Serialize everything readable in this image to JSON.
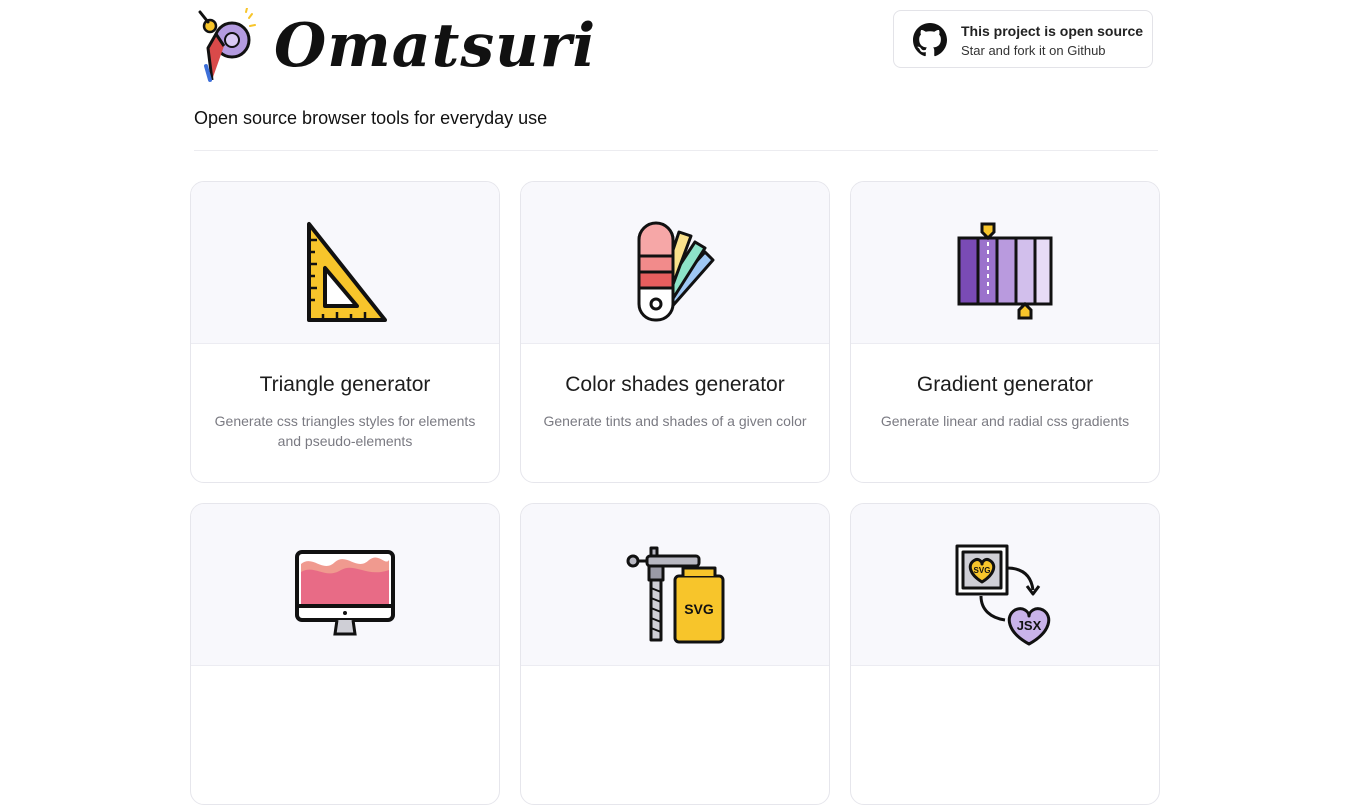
{
  "brand": {
    "name": "Omatsuri",
    "tagline": "Open source browser tools for everyday use"
  },
  "github": {
    "title": "This project is open source",
    "subtitle": "Star and fork it on Github",
    "icon": "github-icon"
  },
  "tools": [
    {
      "title": "Triangle generator",
      "description": "Generate css triangles styles for elements and pseudo-elements",
      "icon": "triangle-ruler-icon"
    },
    {
      "title": "Color shades generator",
      "description": "Generate tints and shades of a given color",
      "icon": "color-swatch-fan-icon"
    },
    {
      "title": "Gradient generator",
      "description": "Generate linear and radial css gradients",
      "icon": "gradient-bar-icon"
    },
    {
      "title": "",
      "description": "",
      "icon": "monitor-waves-icon"
    },
    {
      "title": "",
      "description": "",
      "icon": "svg-clamp-icon"
    },
    {
      "title": "",
      "description": "",
      "icon": "svg-to-jsx-icon"
    }
  ],
  "colors": {
    "card_art_bg": "#f8f8fc",
    "border": "#e6e6ec",
    "muted_text": "#7a7a82",
    "triangle_yellow": "#f7c52b",
    "gradient_purple": "#8a5bbf"
  }
}
